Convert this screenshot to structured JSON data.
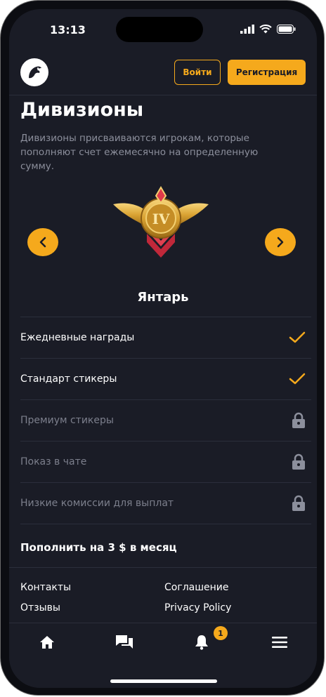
{
  "status_bar": {
    "time": "13:13"
  },
  "header": {
    "login_label": "Войти",
    "register_label": "Регистрация"
  },
  "page": {
    "title": "Дивизионы",
    "description": "Дивизионы присваиваются игрокам, которые пополняют счет ежемесячно на определенную сумму."
  },
  "division": {
    "badge_numeral": "IV",
    "name": "Янтарь",
    "features": [
      {
        "label": "Ежедневные награды",
        "status": "check"
      },
      {
        "label": "Стандарт стикеры",
        "status": "check"
      },
      {
        "label": "Премиум стикеры",
        "status": "lock"
      },
      {
        "label": "Показ в чате",
        "status": "lock"
      },
      {
        "label": "Низкие комиссии для выплат",
        "status": "lock"
      }
    ],
    "requirement": "Пополнить на 3 $ в месяц"
  },
  "footer": {
    "links": [
      "Контакты",
      "Соглашение",
      "Отзывы",
      "Privacy Policy"
    ]
  },
  "bottom_nav": {
    "items": [
      "home-icon",
      "chat-icon",
      "bell-icon",
      "menu-icon"
    ],
    "notification_count": "1"
  },
  "colors": {
    "accent": "#f5a91c",
    "background": "#1a1c26",
    "muted_text": "#8c8f9c"
  }
}
